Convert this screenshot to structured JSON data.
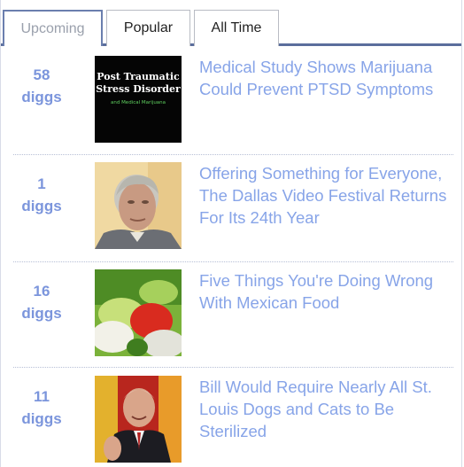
{
  "tabs": [
    {
      "label": "Upcoming",
      "active": true
    },
    {
      "label": "Popular",
      "active": false
    },
    {
      "label": "All Time",
      "active": false
    }
  ],
  "stories": [
    {
      "count": "58",
      "unit": "diggs",
      "title": "Medical Study Shows Marijuana Could Prevent PTSD Symptoms",
      "thumb_text": {
        "line1": "Post Traumatic",
        "line2": "Stress Disorder",
        "line3": "and Medical Marijuana"
      }
    },
    {
      "count": "1",
      "unit": "diggs",
      "title": "Offering Something for Everyone, The Dallas Video Festival Returns For Its 24th Year"
    },
    {
      "count": "16",
      "unit": "diggs",
      "title": "Five Things You're Doing Wrong With Mexican Food"
    },
    {
      "count": "11",
      "unit": "diggs",
      "title": "Bill Would Require Nearly All St. Louis Dogs and Cats to Be Sterilized"
    }
  ],
  "colors": {
    "accent": "#5b6e9c",
    "link": "#87a4e8",
    "digg_count": "#7b95dc"
  }
}
